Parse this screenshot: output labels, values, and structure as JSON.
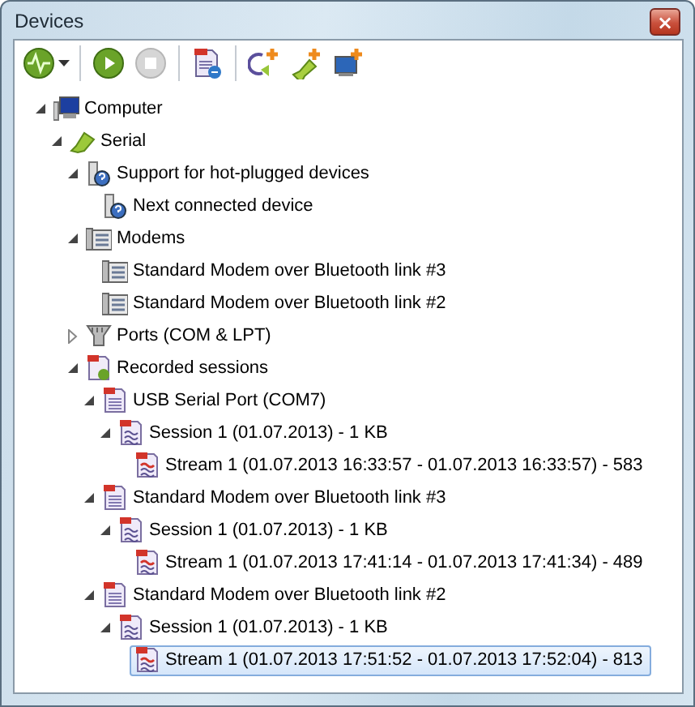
{
  "window": {
    "title": "Devices",
    "close": "×"
  },
  "toolbar": [
    {
      "kind": "monitor",
      "dropdown": true,
      "disabled": false
    },
    {
      "kind": "separator"
    },
    {
      "kind": "start",
      "disabled": false
    },
    {
      "kind": "stop",
      "disabled": true
    },
    {
      "kind": "separator"
    },
    {
      "kind": "open-log",
      "disabled": false
    },
    {
      "kind": "separator"
    },
    {
      "kind": "add-loop",
      "disabled": false
    },
    {
      "kind": "add-serial",
      "disabled": false
    },
    {
      "kind": "add-screen",
      "disabled": false
    }
  ],
  "tree": [
    {
      "label": "Computer",
      "kind": "computer",
      "expanded": true,
      "selected": false,
      "children": [
        {
          "label": "Serial",
          "kind": "serial",
          "expanded": true,
          "selected": false,
          "children": [
            {
              "label": "Support for hot-plugged devices",
              "kind": "hotplug",
              "expanded": true,
              "selected": false,
              "children": [
                {
                  "label": "Next connected device",
                  "kind": "hotplug",
                  "selected": false
                }
              ]
            },
            {
              "label": "Modems",
              "kind": "modem",
              "expanded": true,
              "selected": false,
              "children": [
                {
                  "label": "Standard Modem over Bluetooth link #3",
                  "kind": "modem",
                  "selected": false
                },
                {
                  "label": "Standard Modem over Bluetooth link #2",
                  "kind": "modem",
                  "selected": false
                }
              ]
            },
            {
              "label": "Ports (COM & LPT)",
              "kind": "port",
              "expanded": false,
              "selected": false
            },
            {
              "label": "Recorded sessions",
              "kind": "recorded",
              "expanded": true,
              "selected": false,
              "children": [
                {
                  "label": "USB Serial Port (COM7)",
                  "kind": "log",
                  "expanded": true,
                  "selected": false,
                  "children": [
                    {
                      "label": "Session 1 (01.07.2013) - 1 KB",
                      "kind": "session",
                      "expanded": true,
                      "selected": false,
                      "children": [
                        {
                          "label": "Stream 1 (01.07.2013 16:33:57 - 01.07.2013 16:33:57) - 583",
                          "kind": "stream",
                          "selected": false
                        }
                      ]
                    }
                  ]
                },
                {
                  "label": "Standard Modem over Bluetooth link #3",
                  "kind": "log",
                  "expanded": true,
                  "selected": false,
                  "children": [
                    {
                      "label": "Session 1 (01.07.2013) - 1 KB",
                      "kind": "session",
                      "expanded": true,
                      "selected": false,
                      "children": [
                        {
                          "label": "Stream 1 (01.07.2013 17:41:14 - 01.07.2013 17:41:34) - 489",
                          "kind": "stream",
                          "selected": false
                        }
                      ]
                    }
                  ]
                },
                {
                  "label": "Standard Modem over Bluetooth link #2",
                  "kind": "log",
                  "expanded": true,
                  "selected": false,
                  "children": [
                    {
                      "label": "Session 1 (01.07.2013) - 1 KB",
                      "kind": "session",
                      "expanded": true,
                      "selected": false,
                      "children": [
                        {
                          "label": "Stream 1 (01.07.2013 17:51:52 - 01.07.2013 17:52:04) - 813",
                          "kind": "stream",
                          "selected": true
                        }
                      ]
                    }
                  ]
                }
              ]
            }
          ]
        }
      ]
    }
  ]
}
